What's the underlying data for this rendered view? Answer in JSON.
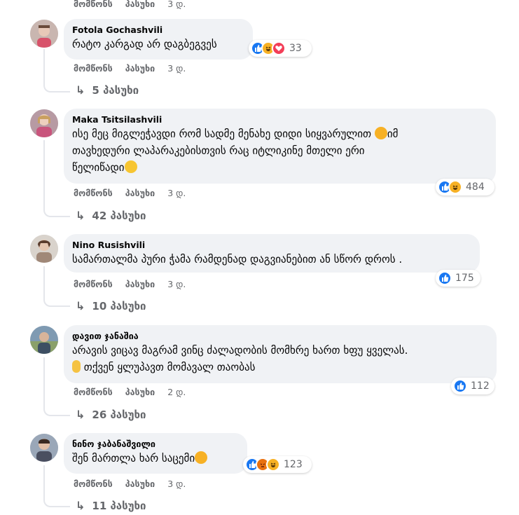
{
  "actions": {
    "like": "მომწონს",
    "reply": "პასუხი"
  },
  "top_row": {
    "time": "3 დ."
  },
  "comments": [
    {
      "author": "Fotola Gochashvili",
      "text": "რატო კარგად არ დაგბეგვეს",
      "reactions": [
        "like",
        "haha",
        "love"
      ],
      "reaction_count": "33",
      "time": "3 დ.",
      "replies": "5 პასუხი"
    },
    {
      "author": "Maka Tsitsilashvili",
      "text_lines": [
        "ისე მეც მიგლეჭავდი რომ სადმე მენახე დიდი სიყვარულით",
        "იმ",
        "თავხედური ლაპარაკებისთვის რაც იტლიკინე მთელი ერი",
        "წელიწადი"
      ],
      "reactions": [
        "like",
        "haha"
      ],
      "reaction_count": "484",
      "time": "3 დ.",
      "replies": "42 პასუხი"
    },
    {
      "author": "Nino Rusishvili",
      "text": "სამართალმა პური ჭამა რამდენად დაგვიანებით ან სწორ დროს .",
      "reactions": [
        "like"
      ],
      "reaction_count": "175",
      "time": "3 დ.",
      "replies": "10 პასუხი"
    },
    {
      "author": "დავით ჯანაშია",
      "text_lines": [
        "არავის ვიცავ მაგრამ ვინც ძალადობის მომხრე ხართ ხფუ ყველას.",
        "თქვენ ყლუპავთ მომავალ თაობას"
      ],
      "reactions": [
        "like"
      ],
      "reaction_count": "112",
      "time": "2 დ.",
      "replies": "26 პასუხი"
    },
    {
      "author": "ნინო ჯაბანაშვილი",
      "text": "შენ მართლა ხარ საცემი",
      "reactions": [
        "like",
        "angry",
        "haha"
      ],
      "reaction_count": "123",
      "time": "3 დ.",
      "replies": "11 პასუხი"
    }
  ]
}
